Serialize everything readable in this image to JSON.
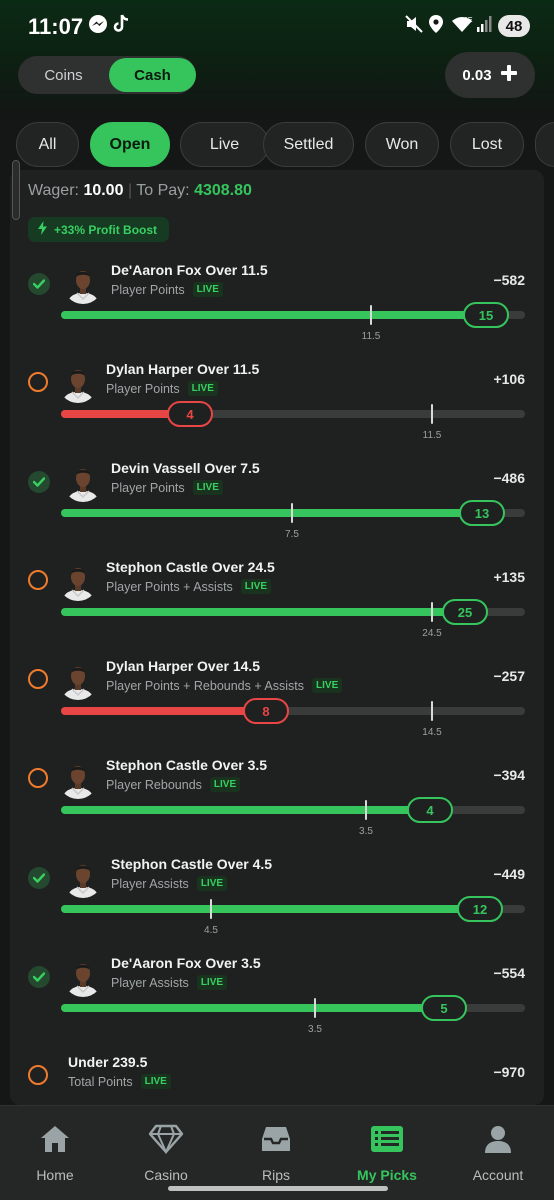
{
  "status_bar": {
    "time": "11:07",
    "battery": "48",
    "network": "6E"
  },
  "header": {
    "toggle": {
      "options": [
        "Coins",
        "Cash"
      ],
      "selected": "Cash"
    },
    "balance": "0.03",
    "add_icon": "plus-icon"
  },
  "tabs": [
    {
      "label": "All",
      "active": false
    },
    {
      "label": "Open",
      "active": true
    },
    {
      "label": "Live",
      "active": false
    },
    {
      "label": "Settled",
      "active": false
    },
    {
      "label": "Won",
      "active": false
    },
    {
      "label": "Lost",
      "active": false
    }
  ],
  "summary": {
    "wager_label": "Wager:",
    "wager_value": "10.00",
    "pay_label": "To Pay:",
    "pay_value": "4308.80",
    "boost": "+33% Profit Boost"
  },
  "live_label": "LIVE",
  "picks": [
    {
      "title": "De'Aaron Fox Over 11.5",
      "market": "Player Points",
      "odds": "−582",
      "status": "won",
      "current": "15",
      "current_num": 15,
      "line": "11.5",
      "line_num": 11.5,
      "bar": "green"
    },
    {
      "title": "Dylan Harper Over 11.5",
      "market": "Player Points",
      "odds": "+106",
      "status": "open",
      "current": "4",
      "current_num": 4,
      "line": "11.5",
      "line_num": 11.5,
      "bar": "red"
    },
    {
      "title": "Devin Vassell Over 7.5",
      "market": "Player Points",
      "odds": "−486",
      "status": "won",
      "current": "13",
      "current_num": 13,
      "line": "7.5",
      "line_num": 7.5,
      "bar": "green"
    },
    {
      "title": "Stephon Castle Over 24.5",
      "market": "Player Points + Assists",
      "odds": "+135",
      "status": "open",
      "current": "25",
      "current_num": 25,
      "line": "24.5",
      "line_num": 24.5,
      "bar": "green"
    },
    {
      "title": "Dylan Harper Over 14.5",
      "market": "Player Points + Rebounds + Assists",
      "odds": "−257",
      "status": "open",
      "current": "8",
      "current_num": 8,
      "line": "14.5",
      "line_num": 14.5,
      "bar": "red"
    },
    {
      "title": "Stephon Castle Over 3.5",
      "market": "Player Rebounds",
      "odds": "−394",
      "status": "open",
      "current": "4",
      "current_num": 4,
      "line": "3.5",
      "line_num": 3.5,
      "bar": "green"
    },
    {
      "title": "Stephon Castle Over 4.5",
      "market": "Player Assists",
      "odds": "−449",
      "status": "won",
      "current": "12",
      "current_num": 12,
      "line": "4.5",
      "line_num": 4.5,
      "bar": "green"
    },
    {
      "title": "De'Aaron Fox Over 3.5",
      "market": "Player Assists",
      "odds": "−554",
      "status": "won",
      "current": "5",
      "current_num": 5,
      "line": "3.5",
      "line_num": 3.5,
      "bar": "green"
    },
    {
      "title": "Under 239.5",
      "market": "Total Points",
      "odds": "−970",
      "status": "open",
      "current": "",
      "line": "",
      "bar": "none"
    }
  ],
  "nav": [
    {
      "label": "Home",
      "icon": "home-icon",
      "active": false
    },
    {
      "label": "Casino",
      "icon": "diamond-icon",
      "active": false
    },
    {
      "label": "Rips",
      "icon": "inbox-tray-icon",
      "active": false
    },
    {
      "label": "My Picks",
      "icon": "picks-list-icon",
      "active": true
    },
    {
      "label": "Account",
      "icon": "person-icon",
      "active": false
    }
  ],
  "colors": {
    "accent_green": "#35c55c",
    "loss_red": "#e84545",
    "open_orange": "#f07b2c",
    "background": "#151616"
  }
}
